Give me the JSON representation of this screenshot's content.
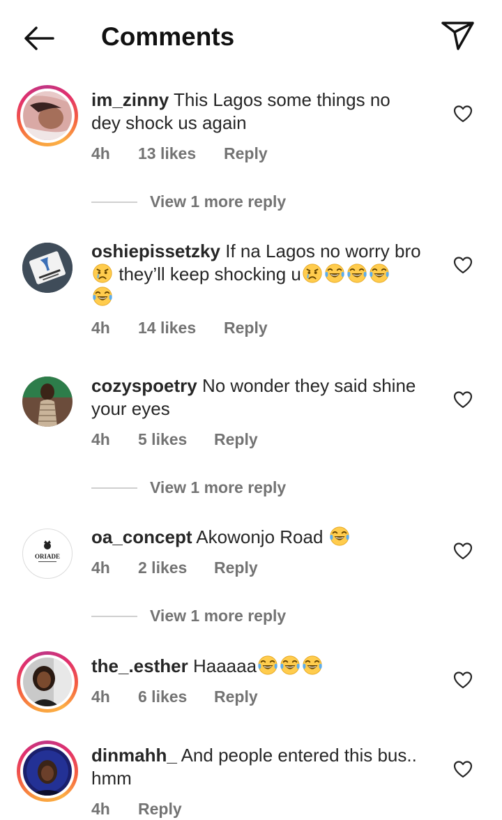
{
  "header": {
    "title": "Comments",
    "back_icon": "arrow-left-icon",
    "share_icon": "paper-plane-icon"
  },
  "comments": [
    {
      "username": "im_zinny",
      "line1": "This Lagos some things no",
      "line2": "dey shock us again",
      "time": "4h",
      "likes": "13 likes",
      "reply": "Reply",
      "view_replies": "View 1 more reply"
    },
    {
      "username": "oshiepissetzky",
      "line1": "If na Lagos no worry bro",
      "line2": "they’ll keep shocking u",
      "time": "4h",
      "likes": "14 likes",
      "reply": "Reply"
    },
    {
      "username": "cozyspoetry",
      "line1": "No wonder they said shine",
      "line2": "your eyes",
      "time": "4h",
      "likes": "5 likes",
      "reply": "Reply",
      "view_replies": "View 1 more reply"
    },
    {
      "username": "oa_concept",
      "line1": "Akowonjo Road",
      "time": "4h",
      "likes": "2 likes",
      "reply": "Reply",
      "view_replies": "View 1 more reply",
      "avatar_logo_text": "ORIADE"
    },
    {
      "username": "the_.esther",
      "line1": "Haaaaa",
      "time": "4h",
      "likes": "6 likes",
      "reply": "Reply"
    },
    {
      "username": "dinmahh_",
      "line1": "And people entered this bus..",
      "line2": "hmm",
      "time": "4h",
      "reply": "Reply"
    }
  ],
  "icons": {
    "emoji_crying": "crying-face-emoji",
    "emoji_laughing": "tears-of-joy-emoji",
    "heart": "heart-outline-icon"
  },
  "colors": {
    "text": "#262626",
    "secondary": "#737373",
    "story_ring_start": "#f9a03f",
    "story_ring_end": "#c13584"
  }
}
